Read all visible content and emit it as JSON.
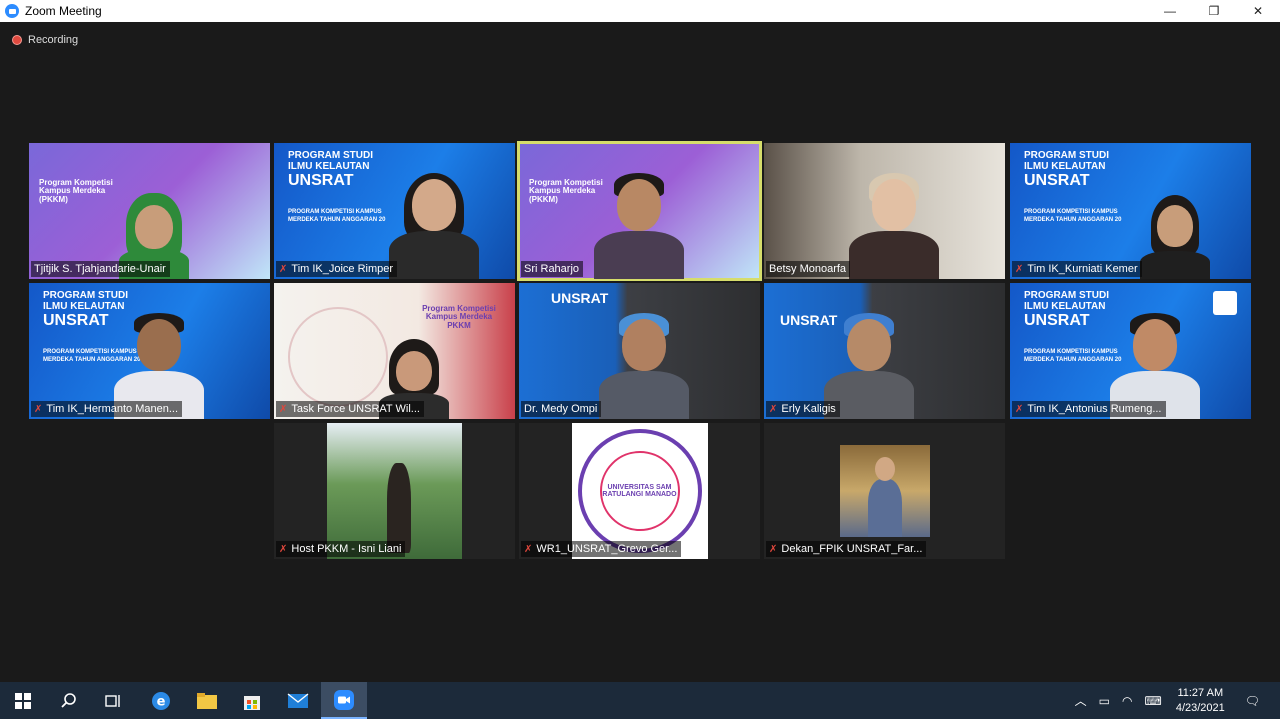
{
  "window": {
    "title": "Zoom Meeting",
    "min": "—",
    "max": "❐",
    "close": "✕"
  },
  "recording": {
    "label": "Recording"
  },
  "slides": {
    "pkkm": "Program Kompetisi Kampus Merdeka (PKKM)",
    "unsrat_title": "PROGRAM STUDI ILMU KELAUTAN",
    "unsrat_big": "UNSRAT",
    "unsrat_sub": "PROGRAM KOMPETISI KAMPUS MERDEKA TAHUN ANGGARAN 20",
    "taskforce_slide": "Program Kompetisi Kampus Merdeka PKKM",
    "logo_text": "UNIVERSITAS SAM RATULANGI MANADO"
  },
  "participants": [
    {
      "name": "Tjitjik S. Tjahjandarie-Unair",
      "muted": false
    },
    {
      "name": "Tim IK_Joice Rimper",
      "muted": true
    },
    {
      "name": "Sri Raharjo",
      "muted": false,
      "active": true
    },
    {
      "name": "Betsy Monoarfa",
      "muted": false
    },
    {
      "name": "Tim IK_Kurniati Kemer",
      "muted": true
    },
    {
      "name": "Tim IK_Hermanto Manen...",
      "muted": true
    },
    {
      "name": "Task Force UNSRAT Wil...",
      "muted": true
    },
    {
      "name": "Dr. Medy Ompi",
      "muted": false
    },
    {
      "name": "Erly Kaligis",
      "muted": true
    },
    {
      "name": "Tim IK_Antonius Rumeng...",
      "muted": true
    },
    {
      "name": "Host PKKM - Isni Liani",
      "muted": true
    },
    {
      "name": "WR1_UNSRAT_Grevo Ger...",
      "muted": true
    },
    {
      "name": "Dekan_FPIK UNSRAT_Far...",
      "muted": true
    }
  ],
  "taskbar": {
    "time": "11:27 AM",
    "date": "4/23/2021"
  },
  "colors": {
    "active_speaker": "#d6dd6b",
    "mute": "#e0473c",
    "taskbar": "#1c2a3a"
  }
}
